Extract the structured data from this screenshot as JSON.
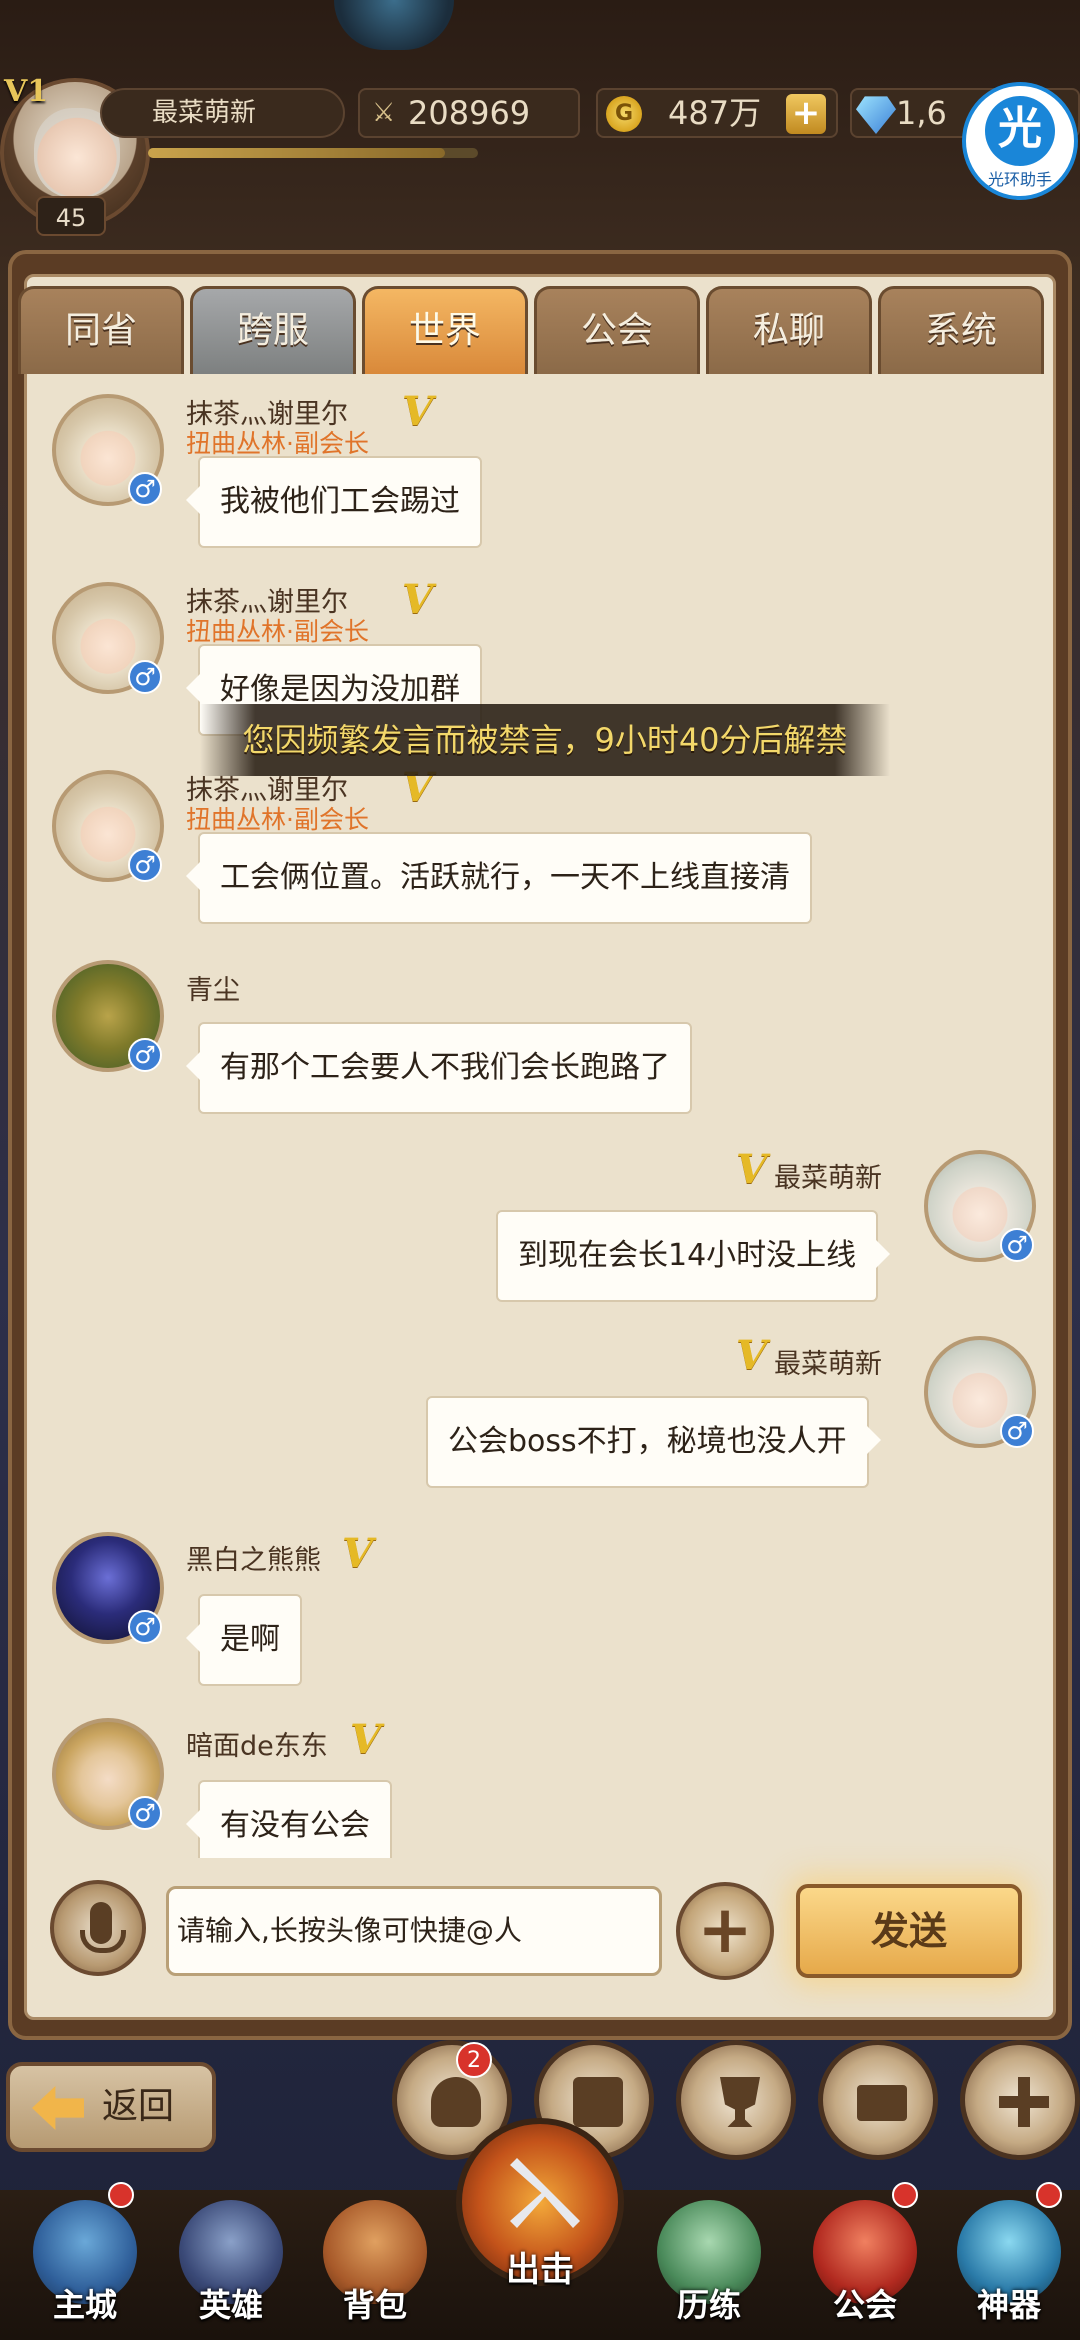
{
  "hud": {
    "vip": "V1",
    "level": "45",
    "player_name": "最菜萌新",
    "power": "208969",
    "gold": "487万",
    "gems": "1,6",
    "helper_logo": "光",
    "helper_label": "光环助手"
  },
  "tabs": [
    {
      "label": "同省",
      "state": "normal"
    },
    {
      "label": "跨服",
      "state": "gray"
    },
    {
      "label": "世界",
      "state": "active"
    },
    {
      "label": "公会",
      "state": "normal"
    },
    {
      "label": "私聊",
      "state": "normal"
    },
    {
      "label": "系统",
      "state": "normal"
    }
  ],
  "messages": [
    {
      "user": "抹茶灬谢里尔",
      "guild": "扭曲丛林·副会长",
      "vip": "V",
      "text": "我被他们工会踢过",
      "side": "left",
      "avatar": "girl"
    },
    {
      "user": "抹茶灬谢里尔",
      "guild": "扭曲丛林·副会长",
      "vip": "V",
      "text": "好像是因为没加群",
      "side": "left",
      "avatar": "girl"
    },
    {
      "user": "抹茶灬谢里尔",
      "guild": "扭曲丛林·副会长",
      "vip": "V",
      "text": "工会俩位置。活跃就行，一天不上线直接清",
      "side": "left",
      "avatar": "girl"
    },
    {
      "user": "青尘",
      "guild": "",
      "vip": "",
      "text": "有那个工会要人不我们会长跑路了",
      "side": "left",
      "avatar": "tree"
    },
    {
      "user": "最菜萌新",
      "guild": "",
      "vip": "V",
      "text": "到现在会长14小时没上线",
      "side": "right",
      "avatar": "elf"
    },
    {
      "user": "最菜萌新",
      "guild": "",
      "vip": "V",
      "text": "公会boss不打，秘境也没人开",
      "side": "right",
      "avatar": "elf"
    },
    {
      "user": "黑白之熊熊",
      "guild": "",
      "vip": "V",
      "text": "是啊",
      "side": "left",
      "avatar": "dark"
    },
    {
      "user": "暗面de东东",
      "guild": "",
      "vip": "V",
      "text": "有没有公会",
      "side": "left",
      "avatar": "blonde"
    }
  ],
  "gender_symbol": "♂",
  "toast": "您因频繁发言而被禁言，9小时40分后解禁",
  "input": {
    "placeholder": "请输入,长按头像可快捷@人",
    "send_label": "发送",
    "add_symbol": "+"
  },
  "back_label": "返回",
  "friends_badge": "2",
  "bottom_nav": [
    {
      "label": "主城",
      "icon": "castle-icon"
    },
    {
      "label": "英雄",
      "icon": "helmet-icon"
    },
    {
      "label": "背包",
      "icon": "backpack-icon"
    },
    {
      "label": "出击",
      "icon": "crossed-swords-icon"
    },
    {
      "label": "历练",
      "icon": "training-icon"
    },
    {
      "label": "公会",
      "icon": "guild-banner-icon"
    },
    {
      "label": "神器",
      "icon": "artifact-icon"
    }
  ],
  "colors": {
    "accent_orange": "#e0742a",
    "vip_gold": "#e5b926",
    "toast_text": "#f3d86a",
    "panel_bg": "#ebe1cc"
  }
}
